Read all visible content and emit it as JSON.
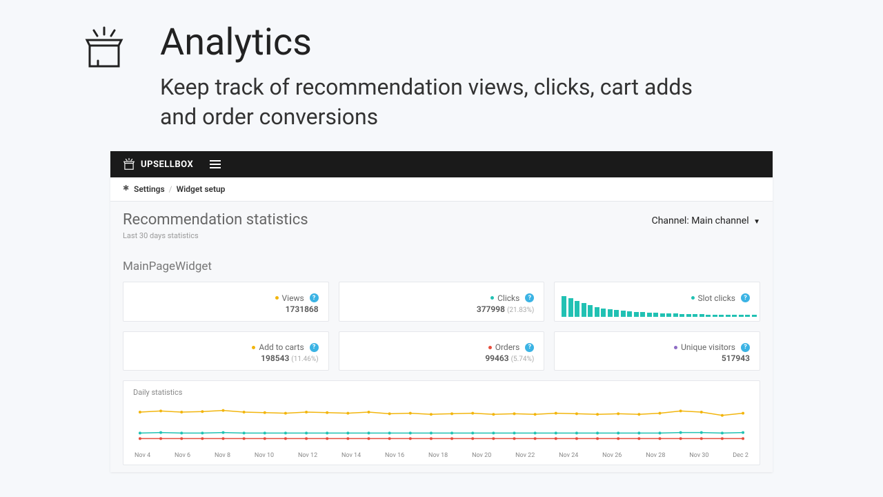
{
  "hero": {
    "title": "Analytics",
    "subtitle": "Keep track of recommendation views, clicks, cart adds and order conversions"
  },
  "topbar": {
    "brand": "UPSELLBOX"
  },
  "breadcrumb": {
    "settings": "Settings",
    "current": "Widget setup"
  },
  "page": {
    "title": "Recommendation statistics",
    "subtitle": "Last 30 days statistics",
    "channel_label": "Channel:",
    "channel_value": "Main channel"
  },
  "widget_name": "MainPageWidget",
  "cards": [
    {
      "label": "Views",
      "value": "1731868",
      "pct": "",
      "color": "#f2b50d"
    },
    {
      "label": "Clicks",
      "value": "377998",
      "pct": "(21.83%)",
      "color": "#21c1b3"
    },
    {
      "label": "Slot clicks",
      "value": "",
      "pct": "",
      "color": "#21c1b3",
      "spark": true
    },
    {
      "label": "Add to carts",
      "value": "198543",
      "pct": "(11.46%)",
      "color": "#f2b50d"
    },
    {
      "label": "Orders",
      "value": "99463",
      "pct": "(5.74%)",
      "color": "#e74c3c"
    },
    {
      "label": "Unique visitors",
      "value": "517943",
      "pct": "",
      "color": "#8e6cc4"
    }
  ],
  "daily": {
    "title": "Daily statistics"
  },
  "chart_data": [
    {
      "type": "bar",
      "name": "Slot clicks sparkline",
      "values": [
        30,
        27,
        23,
        20,
        17,
        14,
        12,
        11,
        10,
        9,
        8,
        7,
        7,
        6,
        6,
        5,
        5,
        5,
        4,
        4,
        4,
        4,
        3,
        3,
        3,
        3,
        3,
        3,
        3,
        3
      ],
      "ylim": [
        0,
        30
      ]
    },
    {
      "type": "line",
      "name": "Daily statistics",
      "categories": [
        "Nov 4",
        "Nov 6",
        "Nov 8",
        "Nov 10",
        "Nov 12",
        "Nov 14",
        "Nov 16",
        "Nov 18",
        "Nov 20",
        "Nov 22",
        "Nov 24",
        "Nov 26",
        "Nov 28",
        "Nov 30",
        "Dec 2"
      ],
      "series": [
        {
          "name": "Views",
          "color": "#f2b50d",
          "values": [
            60,
            62,
            60,
            61,
            63,
            60,
            59,
            58,
            60,
            59,
            58,
            60,
            57,
            58,
            56,
            57,
            58,
            56,
            57,
            56,
            58,
            57,
            56,
            57,
            56,
            58,
            62,
            60,
            54,
            58
          ]
        },
        {
          "name": "Clicks",
          "color": "#21c1b3",
          "values": [
            22,
            23,
            22,
            22,
            23,
            22,
            22,
            22,
            22,
            22,
            22,
            22,
            22,
            22,
            22,
            22,
            22,
            22,
            22,
            22,
            22,
            22,
            22,
            22,
            22,
            22,
            23,
            23,
            22,
            23
          ]
        },
        {
          "name": "Orders",
          "color": "#e74c3c",
          "values": [
            12,
            12,
            12,
            12,
            12,
            12,
            12,
            12,
            12,
            12,
            12,
            12,
            12,
            12,
            12,
            12,
            12,
            12,
            12,
            12,
            12,
            12,
            12,
            12,
            12,
            12,
            12,
            12,
            12,
            12
          ]
        }
      ],
      "ylim": [
        0,
        70
      ]
    }
  ]
}
